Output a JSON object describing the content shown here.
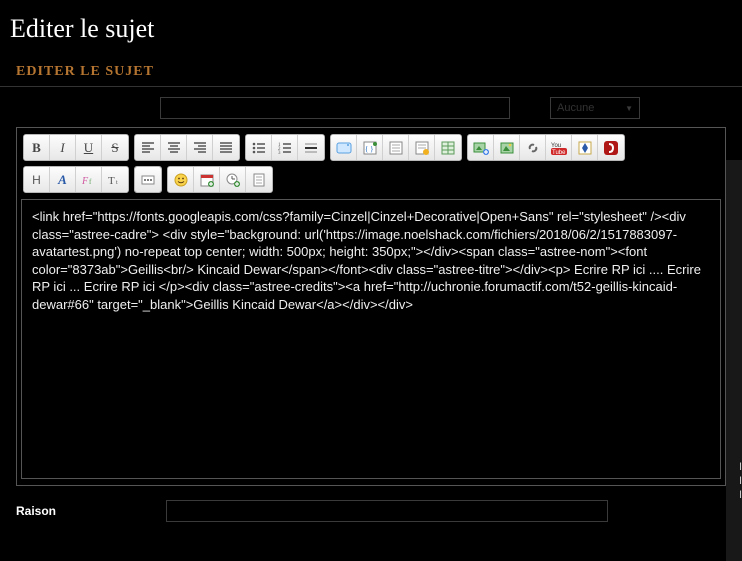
{
  "page": {
    "title": "Editer le sujet",
    "section": "EDITER LE SUJET"
  },
  "top": {
    "subject_value": "",
    "icon_select": "Aucune"
  },
  "toolbar": {
    "row1": {
      "g1": [
        "bold",
        "italic",
        "underline",
        "strike"
      ],
      "g2": [
        "align-left",
        "align-center",
        "align-right",
        "align-justify"
      ],
      "g3": [
        "list-ul",
        "list-ol",
        "hr-line"
      ],
      "g4": [
        "quote",
        "code",
        "spoiler",
        "hidden",
        "table"
      ],
      "g5": [
        "host-image",
        "insert-image",
        "link",
        "youtube",
        "dailymotion",
        "flash"
      ]
    },
    "row2": {
      "g6": [
        "remove-format",
        "font-color",
        "font-family",
        "font-size"
      ],
      "g7": [
        "more"
      ],
      "g8": [
        "emoji",
        "date",
        "time",
        "paste-word"
      ]
    }
  },
  "editor": {
    "content": "<link href=\"https://fonts.googleapis.com/css?family=Cinzel|Cinzel+Decorative|Open+Sans\" rel=\"stylesheet\" /><div class=\"astree-cadre\"> <div style=\"background: url('https://image.noelshack.com/fichiers/2018/06/2/1517883097-avatartest.png') no-repeat top center; width: 500px; height: 350px;\"></div><span class=\"astree-nom\"><font color=\"8373ab\">Geillis<br/> Kincaid Dewar</span></font><div class=\"astree-titre\"></div><p> Ecrire RP ici .... Ecrire RP ici ... Ecrire RP ici </p><div class=\"astree-credits\"><a href=\"http://uchronie.forumactif.com/t52-geillis-kincaid-dewar#66\" target=\"_blank\">Geillis Kincaid Dewar</a></div></div>"
  },
  "bottom": {
    "reason_label": "Raison",
    "reason_value": ""
  },
  "cut": {
    "l1": "I",
    "l2": "I",
    "l3": "I"
  }
}
